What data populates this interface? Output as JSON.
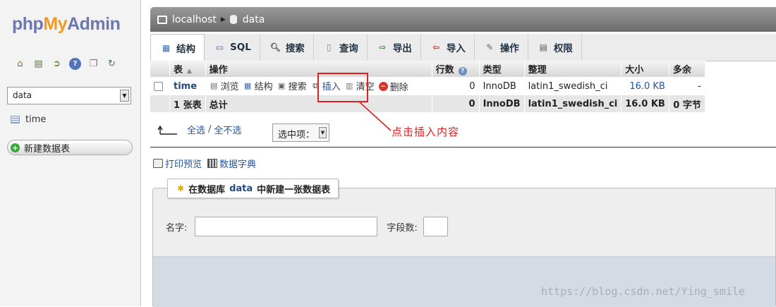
{
  "logo": {
    "php": "php",
    "my": "My",
    "admin": "Admin"
  },
  "sidebar": {
    "db_select": "data",
    "tables": [
      {
        "label": "time"
      }
    ],
    "new_table_label": "新建数据表"
  },
  "breadcrumb": {
    "server": "localhost",
    "database": "data"
  },
  "tabs": [
    {
      "label": "结构",
      "icon": "structure-icon"
    },
    {
      "label": "SQL",
      "icon": "sql-icon"
    },
    {
      "label": "搜索",
      "icon": "search-icon"
    },
    {
      "label": "查询",
      "icon": "query-icon"
    },
    {
      "label": "导出",
      "icon": "export-icon"
    },
    {
      "label": "导入",
      "icon": "import-icon"
    },
    {
      "label": "操作",
      "icon": "wrench-icon"
    },
    {
      "label": "权限",
      "icon": "privileges-icon"
    }
  ],
  "table": {
    "headers": {
      "table": "表",
      "actions": "操作",
      "rows": "行数",
      "type": "类型",
      "collation": "整理",
      "size": "大小",
      "overhead": "多余"
    },
    "rows": [
      {
        "name": "time",
        "rows": "0",
        "type": "InnoDB",
        "collation": "latin1_swedish_ci",
        "size": "16.0 KB",
        "overhead": "-"
      }
    ],
    "actions": {
      "browse": "浏览",
      "structure": "结构",
      "search": "搜索",
      "insert": "插入",
      "empty": "清空",
      "drop": "删除"
    },
    "footer": {
      "count": "1 张表",
      "label": "总计",
      "rows": "0",
      "type": "InnoDB",
      "collation": "latin1_swedish_ci",
      "size": "16.0 KB",
      "overhead": "0 字节"
    }
  },
  "annotation": {
    "text": "点击插入内容",
    "color": "#e02020"
  },
  "bulk": {
    "check_all": "全选",
    "uncheck_all": "全不选",
    "with_selected": "选中项："
  },
  "links": {
    "print": "打印预览",
    "dictionary": "数据字典"
  },
  "create": {
    "legend_prefix": "在数据库",
    "legend_db": "data",
    "legend_suffix": "中新建一张数据表",
    "name_label": "名字:",
    "name_value": "",
    "fields_label": "字段数:",
    "fields_value": ""
  },
  "watermark": "https://blog.csdn.net/Ying_smile"
}
